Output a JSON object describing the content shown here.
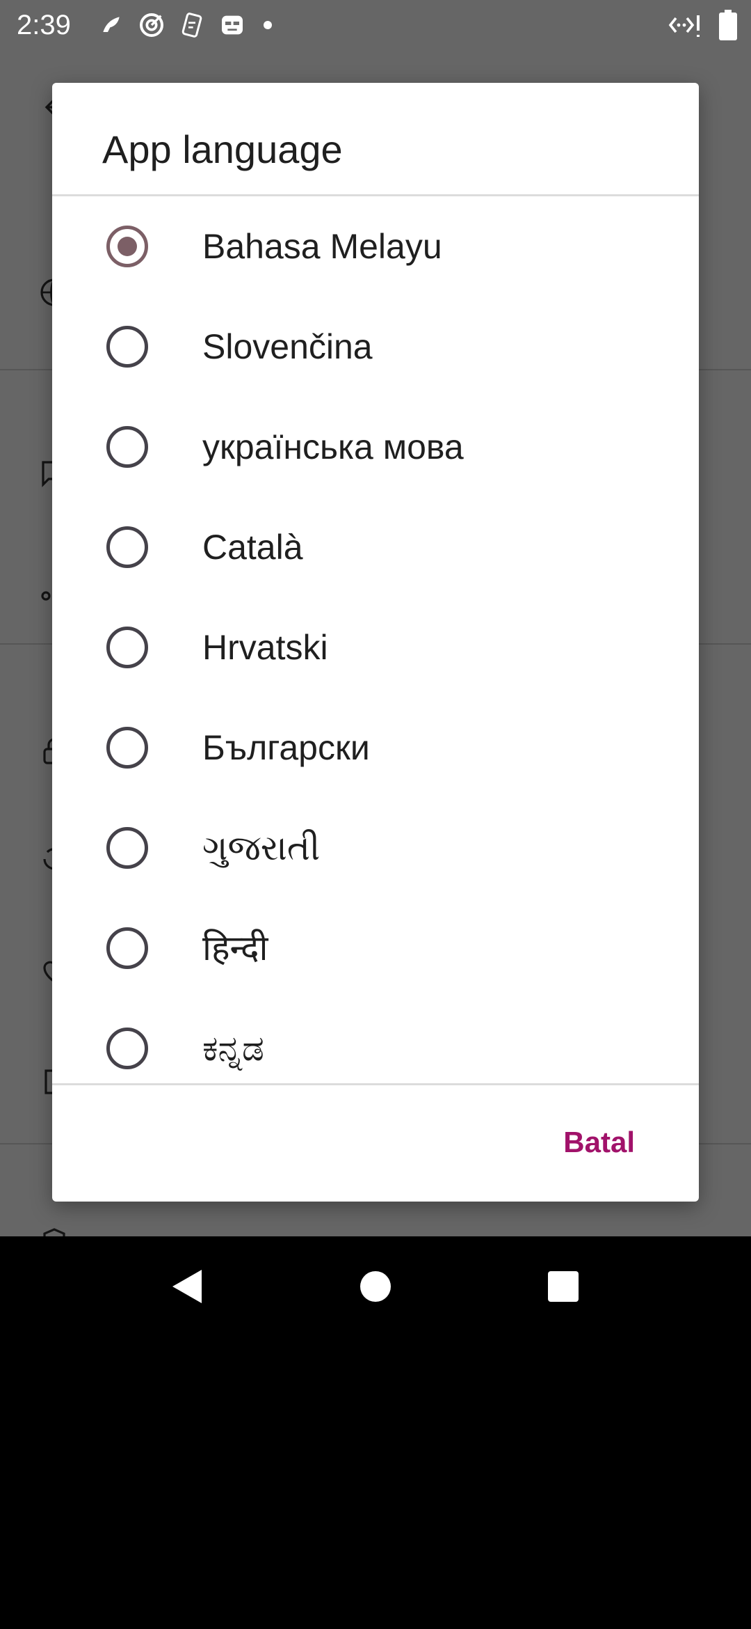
{
  "status_bar": {
    "time": "2:39",
    "left_icons": [
      "app-notification-icon",
      "target-icon",
      "media-notification-icon",
      "mask-icon",
      "dot-icon"
    ],
    "right_icons": [
      "data-signal-icon",
      "battery-icon"
    ]
  },
  "dialog": {
    "title": "App language",
    "options": [
      {
        "label": "Bahasa Melayu",
        "checked": true
      },
      {
        "label": "Slovenčina",
        "checked": false
      },
      {
        "label": "українська мова",
        "checked": false
      },
      {
        "label": "Català",
        "checked": false
      },
      {
        "label": "Hrvatski",
        "checked": false
      },
      {
        "label": "Български",
        "checked": false
      },
      {
        "label": "ગુજરાતી",
        "checked": false
      },
      {
        "label": "हिन्दी",
        "checked": false
      },
      {
        "label": "ಕನ್ನಡ",
        "checked": false
      }
    ],
    "cancel_label": "Batal"
  },
  "colors": {
    "accent": "#a1126a",
    "radio_checked": "#7c5f66",
    "radio_unchecked": "#45424a"
  },
  "navigation": {
    "buttons": [
      "back-icon",
      "home-icon",
      "recents-icon"
    ]
  }
}
